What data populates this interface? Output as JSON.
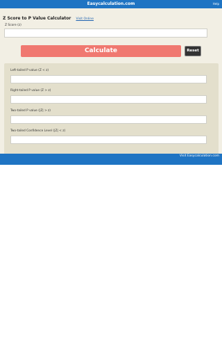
{
  "app": {
    "title": "Easycalculation.com",
    "help_label": "Help"
  },
  "header": {
    "title": "Z Score to P Value Calculator",
    "visit_link": "Visit Online"
  },
  "input": {
    "label": "Z Score (z)",
    "value": ""
  },
  "actions": {
    "calculate_label": "Calculate",
    "reset_label": "Reset"
  },
  "results": [
    {
      "label": "Left-tailed P value (Z < z)",
      "value": ""
    },
    {
      "label": "Right-tailed P value (Z > z)",
      "value": ""
    },
    {
      "label": "Two-tailed P value (|Z| > z)",
      "value": ""
    },
    {
      "label": "Two-tailed Confidence Level (|Z| < z)",
      "value": ""
    }
  ],
  "footer": {
    "visit_label": "Visit Easycalculation.com"
  },
  "colors": {
    "bar_blue": "#1f74c3",
    "calculate": "#f07870",
    "reset": "#333333",
    "panel": "#f2efe4",
    "results_bg": "#e3dfcc"
  }
}
